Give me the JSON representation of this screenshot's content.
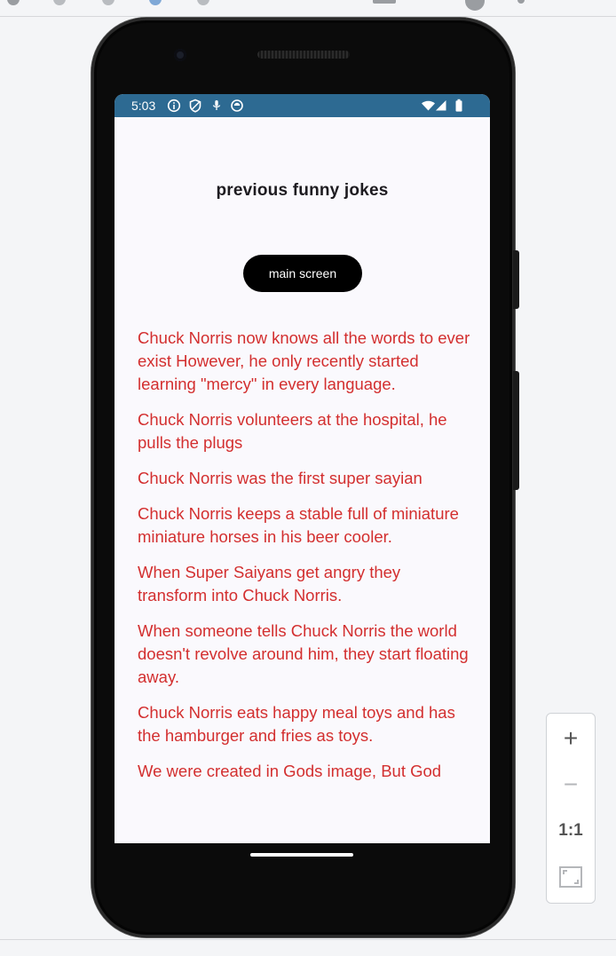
{
  "status_bar": {
    "time": "5:03",
    "left_icons": [
      "info-icon",
      "shield-icon",
      "microphone-off-icon",
      "vpn-icon"
    ],
    "right_icons": [
      "wifi-icon",
      "signal-icon",
      "battery-icon"
    ],
    "color": "#2d6a92"
  },
  "screen": {
    "title": "previous funny jokes",
    "main_button_label": "main screen",
    "joke_color": "#d32f2f",
    "jokes": [
      "Chuck Norris now knows all the words to ever exist However, he only recently started learning \"mercy\" in every language.",
      "Chuck Norris volunteers at the hospital, he pulls the plugs",
      "Chuck Norris was the first super sayian",
      "Chuck Norris keeps a stable full of miniature miniature horses in his beer cooler.",
      "When Super Saiyans get angry they transform into Chuck Norris.",
      "When someone tells Chuck Norris the world doesn't revolve around him, they start floating away.",
      "Chuck Norris eats happy meal toys and has the hamburger and fries as toys.",
      "We were created in Gods image, But God"
    ]
  },
  "zoom_controls": {
    "zoom_in": "+",
    "zoom_out": "−",
    "actual_size": "1:1",
    "fit_icon": "fit-screen-icon"
  }
}
